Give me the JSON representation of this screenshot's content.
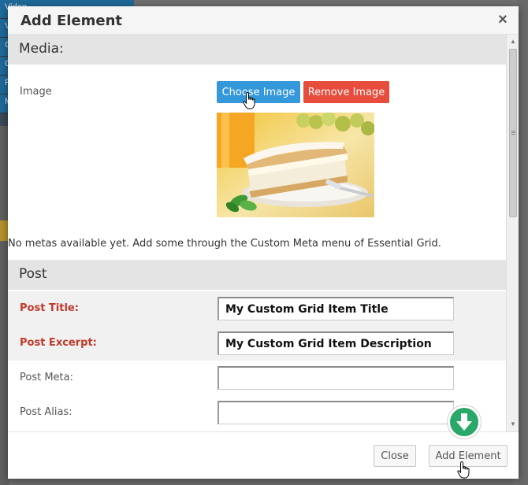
{
  "background": {
    "sidebar_items": [
      "Video",
      "V",
      "Cl",
      "C",
      "Po",
      "M"
    ]
  },
  "modal": {
    "title": "Add Element",
    "close_glyph": "×",
    "media": {
      "heading": "Media:",
      "image_label": "Image",
      "choose_button": "Choose Image",
      "remove_button": "Remove Image",
      "no_metas_text": "No metas available yet. Add some through the Custom Meta menu of Essential Grid."
    },
    "post": {
      "heading": "Post",
      "fields": {
        "title": {
          "label": "Post Title:",
          "value": "My Custom Grid Item Title",
          "required": true
        },
        "excerpt": {
          "label": "Post Excerpt:",
          "value": "My Custom Grid Item Description",
          "required": true
        },
        "meta": {
          "label": "Post Meta:",
          "value": ""
        },
        "alias": {
          "label": "Post Alias:",
          "value": ""
        }
      }
    },
    "footer": {
      "close_button": "Close",
      "add_button": "Add Element"
    }
  },
  "icons": {
    "close": "close-icon",
    "download_badge": "arrow-down-circle-icon",
    "cursor": "hand-pointer-icon"
  },
  "colors": {
    "choose_button": "#3498db",
    "remove_button": "#e74c3c",
    "required_label": "#c0392b",
    "badge": "#2aa86a",
    "section_header_bg": "#e4e4e4"
  }
}
